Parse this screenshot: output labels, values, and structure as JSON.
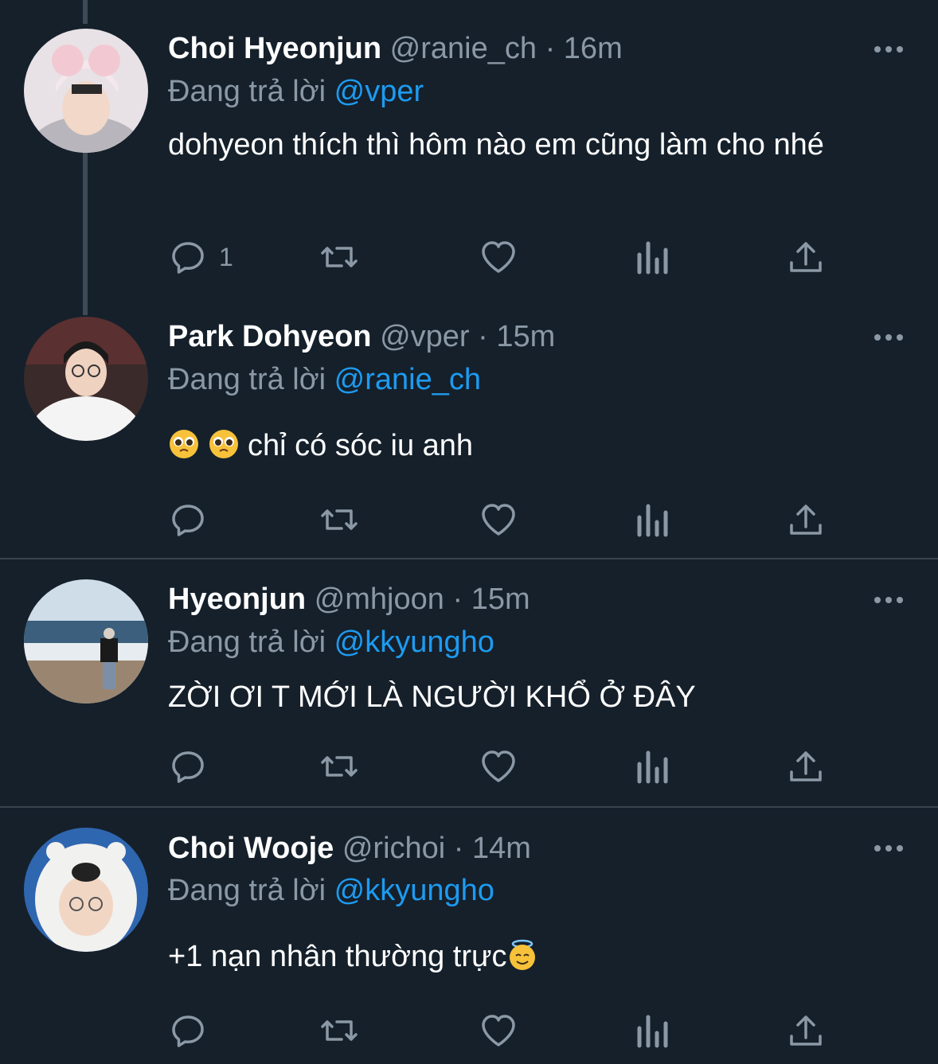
{
  "tweets": [
    {
      "name": "Choi Hyeonjun",
      "handle": "@ranie_ch",
      "dot": "·",
      "time": "16m",
      "replying_prefix": "Đang trả lời",
      "replying_to": "@vper",
      "text": "dohyeon thích thì hôm nào em cũng làm cho nhé",
      "reply_count": "1"
    },
    {
      "name": "Park Dohyeon",
      "handle": "@vper",
      "dot": "·",
      "time": "15m",
      "replying_prefix": "Đang trả lời",
      "replying_to": "@ranie_ch",
      "text": "chỉ có sóc iu anh",
      "reply_count": ""
    },
    {
      "name": "Hyeonjun",
      "handle": "@mhjoon",
      "dot": "·",
      "time": "15m",
      "replying_prefix": "Đang trả lời",
      "replying_to": "@kkyungho",
      "text": "ZỜI ƠI T MỚI LÀ NGƯỜI KHỔ Ở ĐÂY",
      "reply_count": ""
    },
    {
      "name": "Choi Wooje",
      "handle": "@richoi",
      "dot": "·",
      "time": "14m",
      "replying_prefix": "Đang trả lời",
      "replying_to": "@kkyungho",
      "text": "+1 nạn nhân thường trực",
      "reply_count": ""
    }
  ],
  "icons": {
    "reply": "reply-icon",
    "retweet": "retweet-icon",
    "like": "heart-icon",
    "views": "views-icon",
    "share": "share-icon",
    "more": "more-options-icon"
  },
  "colors": {
    "background": "#15202b",
    "text": "#ffffff",
    "muted": "#8b98a5",
    "link": "#1d9bf0",
    "divider": "#38444d"
  }
}
